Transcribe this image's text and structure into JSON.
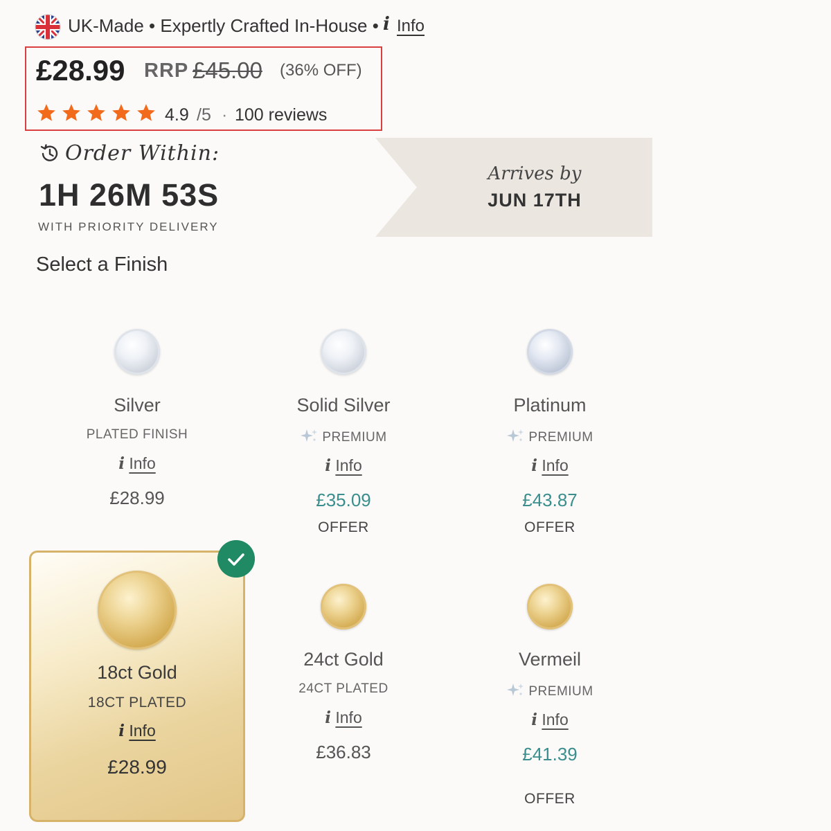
{
  "banner": {
    "text": "UK-Made • Expertly Crafted In-House •",
    "info_icon": "i",
    "info_label": "Info"
  },
  "pricing": {
    "price": "£28.99",
    "rrp_label": "RRP",
    "rrp_value": "£45.00",
    "discount": "(36% OFF)",
    "star_count": 5,
    "star_color": "#f26b1d",
    "rating": "4.9",
    "rating_denominator": "/5",
    "separator": "·",
    "reviews": "100 reviews"
  },
  "delivery": {
    "order_within_label": "Order Within:",
    "timer": "1H 26M 53S",
    "priority_text": "WITH PRIORITY DELIVERY",
    "arrives_by_label": "Arrives by",
    "arrival_date": "JUN 17TH"
  },
  "finish_section": {
    "title": "Select a Finish",
    "info_icon": "i",
    "options": [
      {
        "name": "Silver",
        "subtitle": "PLATED FINISH",
        "premium": false,
        "info_label": "Info",
        "price": "£28.99",
        "offer": "",
        "selected": false,
        "swatch": "silver"
      },
      {
        "name": "Solid Silver",
        "subtitle": "PREMIUM",
        "premium": true,
        "info_label": "Info",
        "price": "£35.09",
        "offer": "OFFER",
        "selected": false,
        "swatch": "silver"
      },
      {
        "name": "Platinum",
        "subtitle": "PREMIUM",
        "premium": true,
        "info_label": "Info",
        "price": "£43.87",
        "offer": "OFFER",
        "selected": false,
        "swatch": "platinum"
      },
      {
        "name": "18ct Gold",
        "subtitle": "18CT PLATED",
        "premium": false,
        "info_label": "Info",
        "price": "£28.99",
        "offer": "",
        "selected": true,
        "swatch": "gold"
      },
      {
        "name": "24ct Gold",
        "subtitle": "24CT PLATED",
        "premium": false,
        "info_label": "Info",
        "price": "£36.83",
        "offer": "",
        "selected": false,
        "swatch": "gold"
      },
      {
        "name": "Vermeil",
        "subtitle": "PREMIUM",
        "premium": true,
        "info_label": "Info",
        "price": "£41.39",
        "offer": "OFFER",
        "selected": false,
        "swatch": "gold"
      }
    ]
  },
  "colors": {
    "offer_price": "#3a8e8e",
    "selected_check": "#1f8a64",
    "selected_border": "#d7b36a",
    "price_box_border": "#d93f3f"
  }
}
